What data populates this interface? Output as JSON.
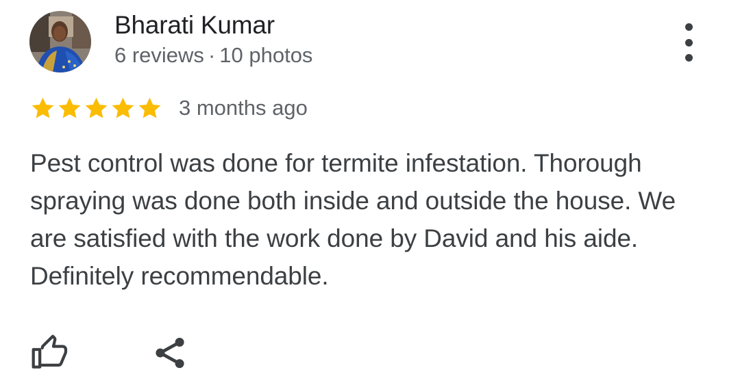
{
  "review": {
    "author_name": "Bharati Kumar",
    "reviews_count": "6 reviews",
    "separator": "·",
    "photos_count": "10 photos",
    "rating": 5,
    "rating_max": 5,
    "date": "3 months ago",
    "text": "Pest control was done for termite infestation. Thorough spraying was done both inside and outside the house. We are satisfied with the work done by David and his aide. Definitely recommendable."
  },
  "icons": {
    "more": "more-vert-icon",
    "star": "star-icon",
    "like": "thumb-up-icon",
    "share": "share-icon"
  },
  "colors": {
    "star": "#fbbc04",
    "name": "#202124",
    "meta": "#5f6368",
    "body_text": "#3c4043",
    "icon": "#3c4043"
  }
}
